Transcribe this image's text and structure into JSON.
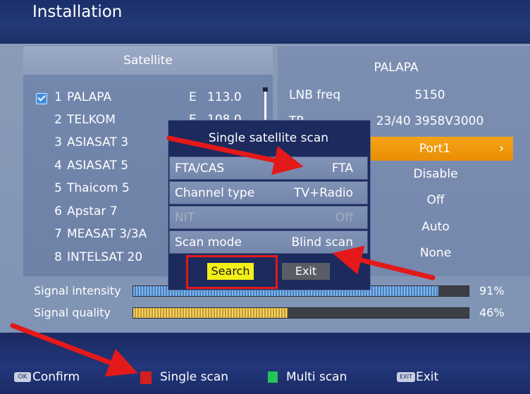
{
  "header": {
    "title": "Installation"
  },
  "satellite_panel": {
    "heading": "Satellite",
    "items": [
      {
        "num": "1",
        "name": "PALAPA",
        "dir": "E",
        "deg": "113.0",
        "checked": true
      },
      {
        "num": "2",
        "name": "TELKOM",
        "dir": "E",
        "deg": "108.0",
        "checked": false
      },
      {
        "num": "3",
        "name": "ASIASAT 3",
        "dir": "",
        "deg": "",
        "checked": false
      },
      {
        "num": "4",
        "name": "ASIASAT 5",
        "dir": "",
        "deg": "",
        "checked": false
      },
      {
        "num": "5",
        "name": "Thaicom 5",
        "dir": "",
        "deg": "",
        "checked": false
      },
      {
        "num": "6",
        "name": "Apstar 7",
        "dir": "",
        "deg": "",
        "checked": false
      },
      {
        "num": "7",
        "name": "MEASAT 3/3A",
        "dir": "",
        "deg": "",
        "checked": false
      },
      {
        "num": "8",
        "name": "INTELSAT 20",
        "dir": "",
        "deg": "",
        "checked": false
      }
    ]
  },
  "detail_panel": {
    "title": "PALAPA",
    "lnb_label": "LNB freq",
    "lnb_value": "5150",
    "tp_label": "TP",
    "tp_value": "23/40 3958V3000",
    "port_value": "Port1",
    "row4_value": "Disable",
    "row5_value": "Off",
    "row6_value": "Auto",
    "row7_value": "None"
  },
  "signal": {
    "intensity_label": "Signal intensity",
    "intensity_value": "91%",
    "intensity_level": 0.91,
    "quality_label": "Signal quality",
    "quality_value": "46%",
    "quality_level": 0.46
  },
  "dialog": {
    "title": "Single satellite scan",
    "rows": [
      {
        "key": "FTA/CAS",
        "value": "FTA"
      },
      {
        "key": "Channel type",
        "value": "TV+Radio"
      },
      {
        "key": "NIT",
        "value": "Off"
      },
      {
        "key": "Scan mode",
        "value": "Blind scan"
      }
    ],
    "search_label": "Search",
    "exit_label": "Exit"
  },
  "footer": {
    "ok_icon_text": "OK",
    "confirm_label": "Confirm",
    "single_scan_label": "Single scan",
    "multi_scan_label": "Multi scan",
    "exit_icon_text": "EXIT",
    "exit_label": "Exit"
  },
  "colors": {
    "selection": "#ef9a0c",
    "search_button": "#f4ef19",
    "annotation": "#e41919",
    "single_scan_key": "#d41f1f",
    "multi_scan_key": "#26c35b"
  }
}
